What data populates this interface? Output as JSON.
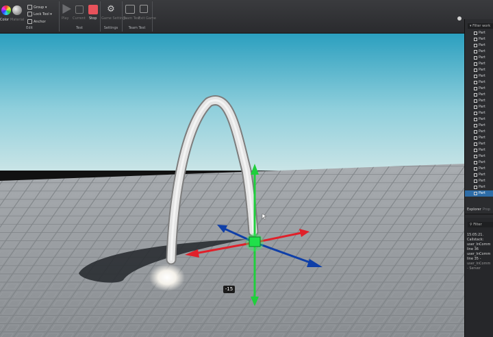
{
  "toolbar": {
    "color_label": "Color",
    "material_label": "Material",
    "group_label": "Group",
    "lock_label": "Lock Tool",
    "anchor_label": "Anchor",
    "play_label": "Play",
    "resume_label": "Current",
    "stop_label": "Stop",
    "game_settings_label": "Game Settings",
    "team_test_label": "Team Test",
    "exit_game_label": "Exit Game",
    "group_edit": "Edit",
    "group_test": "Test",
    "group_settings": "Settings",
    "group_team_test": "Team Test",
    "colors": {
      "stop": "#e8525b",
      "accent": "#2d6ca7"
    }
  },
  "explorer": {
    "filter_placeholder": "Filter work",
    "items": [
      "Part",
      "Part",
      "Part",
      "Part",
      "Part",
      "Part",
      "Part",
      "Part",
      "Part",
      "Part",
      "Part",
      "Part",
      "Part",
      "Part",
      "Part",
      "Part",
      "Part",
      "Part",
      "Part",
      "Part",
      "Part",
      "Part",
      "Part",
      "Part",
      "Part",
      "Part",
      "Part"
    ],
    "selected_index": 26
  },
  "tabs": {
    "explorer": "Explorer",
    "properties": "Prop"
  },
  "output": {
    "filter_placeholder": "Filter",
    "lines": [
      "15:05:21.",
      "Callstack:",
      "user_InComm",
      "line 36",
      "user_InComm",
      "line 35 - ",
      "user_InComm",
      "  - Server"
    ]
  },
  "viewport": {
    "drag_value": "-15"
  }
}
